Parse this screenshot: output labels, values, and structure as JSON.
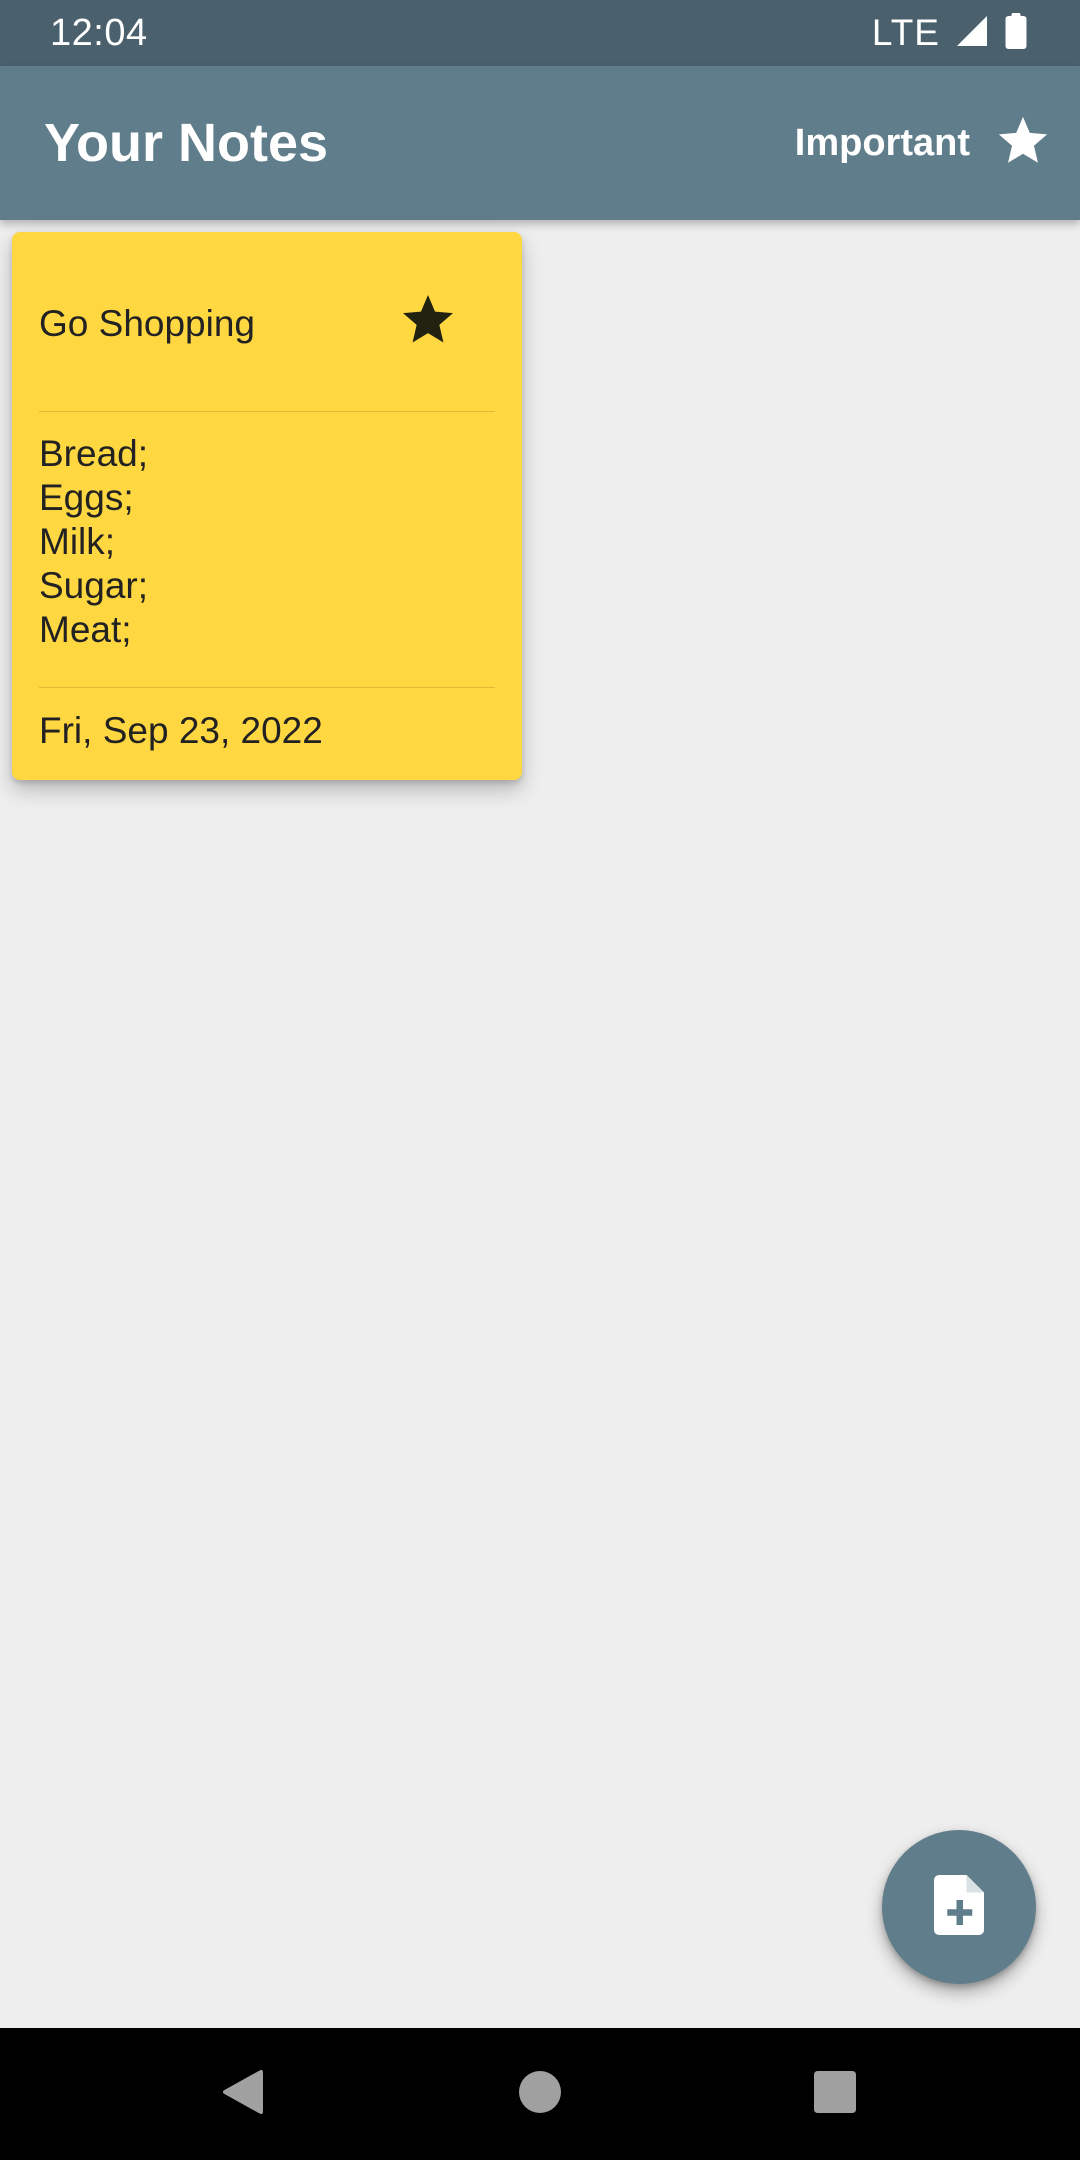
{
  "status_bar": {
    "time": "12:04",
    "network": "LTE",
    "icons": [
      "signal-icon",
      "battery-icon"
    ]
  },
  "app_bar": {
    "title": "Your Notes",
    "important_label": "Important",
    "important_icon": "star-icon"
  },
  "notes": [
    {
      "title": "Go Shopping",
      "important": true,
      "body_lines": [
        "Bread;",
        "Eggs;",
        "Milk;",
        "Sugar;",
        "Meat;"
      ],
      "date": "Fri, Sep 23, 2022",
      "color": "#ffd740"
    }
  ],
  "fab": {
    "icon": "note-add-icon"
  },
  "nav_bar": {
    "icons": [
      "back-icon",
      "home-icon",
      "recents-icon"
    ]
  },
  "colors": {
    "status_bar": "#4a616d",
    "app_bar": "#607d8b",
    "background": "#eeeeee",
    "note_yellow": "#ffd740",
    "fab": "#607d8b"
  }
}
